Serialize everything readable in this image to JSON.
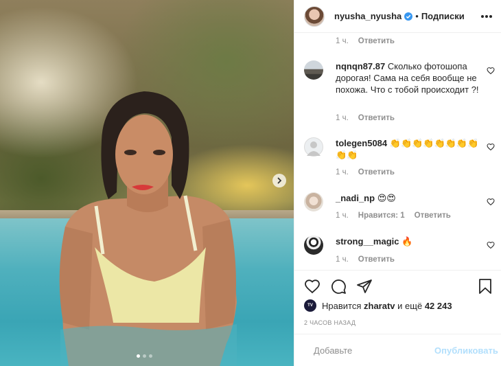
{
  "header": {
    "username": "nyusha_nyusha",
    "separator": "•",
    "follow_state": "Подписки"
  },
  "comments_top_meta": {
    "time": "1 ч.",
    "reply": "Ответить"
  },
  "comments": [
    {
      "username": "nqnqn87.87",
      "text": "Сколько фотошопа дорогая! Сама на себя вообще не похожа. Что с тобой происходит ?!",
      "time": "1 ч.",
      "reply": "Ответить"
    },
    {
      "username": "tolegen5084",
      "text": "👏👏👏👏👏👏👏👏👏👏",
      "time": "1 ч.",
      "reply": "Ответить"
    },
    {
      "username": "_nadi_np",
      "text": "😍😍",
      "time": "1 ч.",
      "likes": "Нравится: 1",
      "reply": "Ответить"
    },
    {
      "username": "strong__magic",
      "text": "🔥",
      "time": "1 ч.",
      "reply": "Ответить"
    }
  ],
  "likes": {
    "prefix": "Нравится",
    "user": "zharatv",
    "middle": "и ещё",
    "count": "42 243"
  },
  "timeago": "2 ЧАСОВ НАЗАД",
  "add_comment": {
    "placeholder": "Добавьте",
    "publish_label": "Опубликовать"
  },
  "carousel": {
    "total": 3,
    "active": 1
  },
  "colors": {
    "text": "#262626",
    "muted": "#8e8e8e",
    "verified": "#3897f0",
    "publish_disabled": "#b2dffc"
  }
}
